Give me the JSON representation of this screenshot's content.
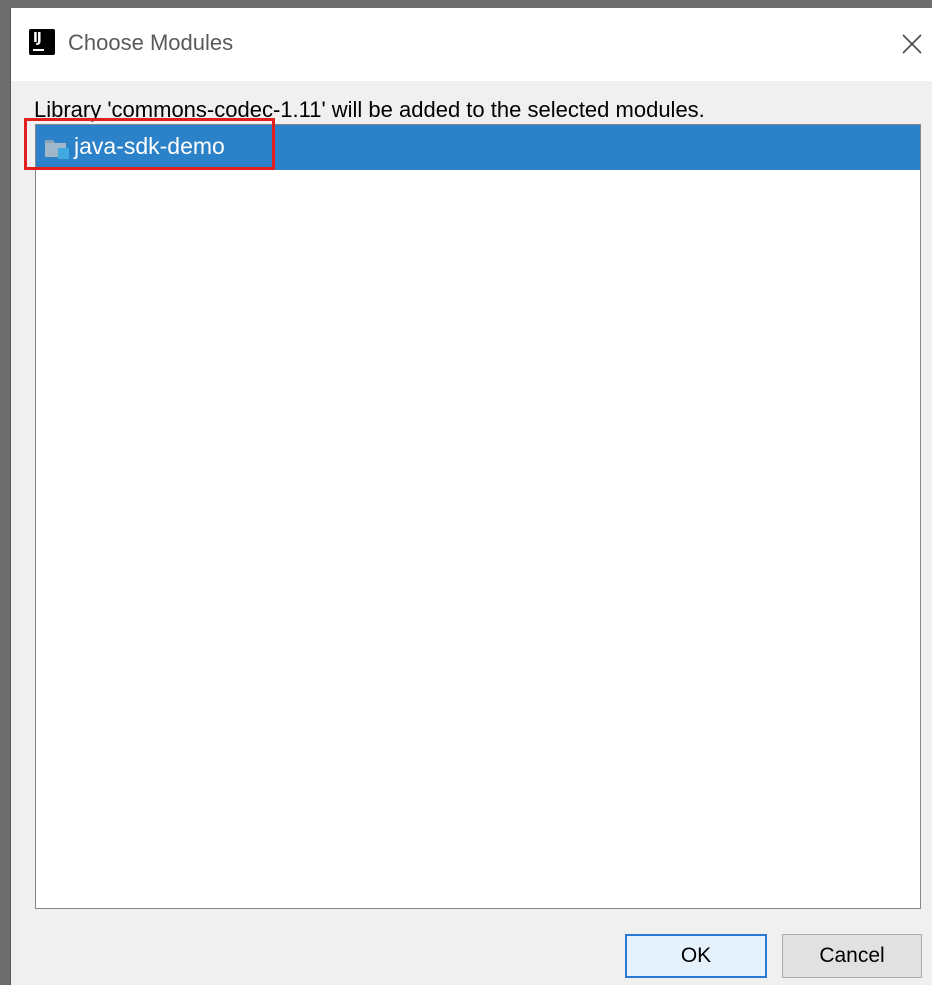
{
  "window": {
    "title": "Choose Modules",
    "app_icon_text": "IJ",
    "close_icon": "close-icon"
  },
  "main": {
    "description": "Library 'commons-codec-1.11' will be added to the selected modules.",
    "modules": [
      {
        "label": "java-sdk-demo",
        "icon": "module-folder-icon",
        "selected": true
      }
    ]
  },
  "buttons": {
    "ok_label": "OK",
    "cancel_label": "Cancel"
  },
  "colors": {
    "selection": "#2c82c9",
    "highlight_annotation": "#e02020",
    "dialog_background": "#f0f0f0",
    "default_button_border": "#2a7ad5"
  }
}
